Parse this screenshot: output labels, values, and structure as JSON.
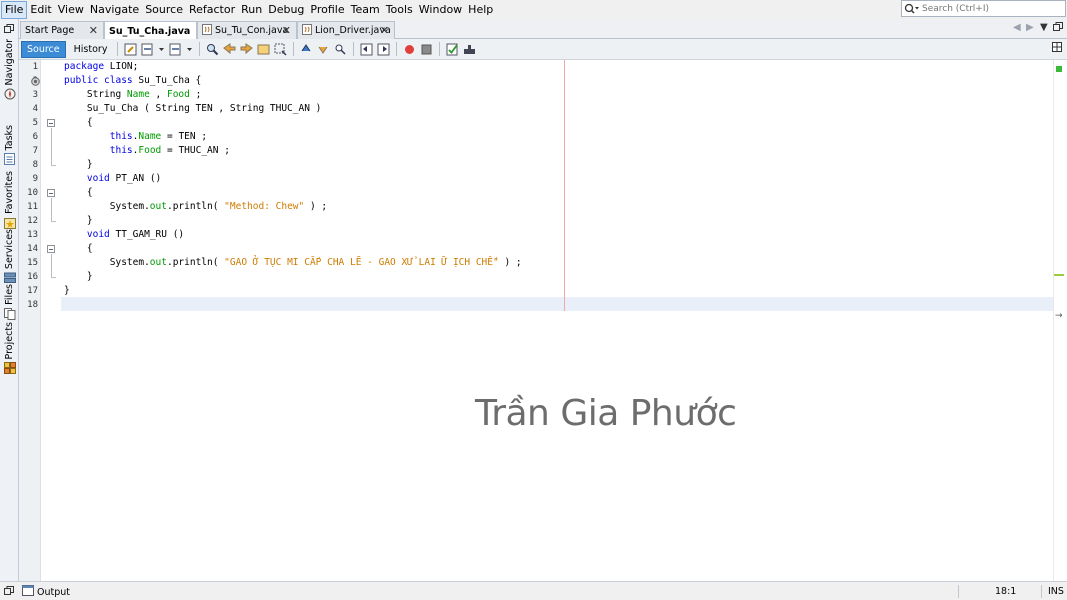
{
  "menu": [
    "File",
    "Edit",
    "View",
    "Navigate",
    "Source",
    "Refactor",
    "Run",
    "Debug",
    "Profile",
    "Team",
    "Tools",
    "Window",
    "Help"
  ],
  "search": {
    "placeholder": "Search (Ctrl+I)"
  },
  "sidebar": {
    "items": [
      {
        "label": "Navigator",
        "icon": "navigator-icon"
      },
      {
        "label": "Tasks",
        "icon": "tasks-icon"
      },
      {
        "label": "Favorites",
        "icon": "favorites-icon"
      },
      {
        "label": "Services",
        "icon": "services-icon"
      },
      {
        "label": "Files",
        "icon": "files-icon"
      },
      {
        "label": "Projects",
        "icon": "projects-icon"
      }
    ]
  },
  "tabs": [
    {
      "label": "Start Page",
      "active": false
    },
    {
      "label": "Su_Tu_Cha.java",
      "active": true
    },
    {
      "label": "Su_Tu_Con.java",
      "active": false
    },
    {
      "label": "Lion_Driver.java",
      "active": false
    }
  ],
  "toolbar": {
    "source_label": "Source",
    "history_label": "History"
  },
  "code": {
    "line_numbers": [
      "1",
      "2",
      "3",
      "4",
      "5",
      "6",
      "7",
      "8",
      "9",
      "10",
      "11",
      "12",
      "13",
      "14",
      "15",
      "16",
      "17",
      "18"
    ],
    "lines": [
      [
        {
          "t": "package ",
          "c": "kw"
        },
        {
          "t": "LION;",
          "c": ""
        }
      ],
      [
        {
          "t": "public class ",
          "c": "kw"
        },
        {
          "t": "Su_Tu_Cha {",
          "c": ""
        }
      ],
      [
        {
          "t": "    String ",
          "c": ""
        },
        {
          "t": "Name",
          "c": "fld"
        },
        {
          "t": " , ",
          "c": ""
        },
        {
          "t": "Food",
          "c": "fld"
        },
        {
          "t": " ;",
          "c": ""
        }
      ],
      [
        {
          "t": "    Su_Tu_Cha ( String TEN , String THUC_AN )",
          "c": ""
        }
      ],
      [
        {
          "t": "    {",
          "c": ""
        }
      ],
      [
        {
          "t": "        ",
          "c": ""
        },
        {
          "t": "this",
          "c": "kw"
        },
        {
          "t": ".",
          "c": ""
        },
        {
          "t": "Name",
          "c": "fld"
        },
        {
          "t": " = TEN ;",
          "c": ""
        }
      ],
      [
        {
          "t": "        ",
          "c": ""
        },
        {
          "t": "this",
          "c": "kw"
        },
        {
          "t": ".",
          "c": ""
        },
        {
          "t": "Food",
          "c": "fld"
        },
        {
          "t": " = THUC_AN ;",
          "c": ""
        }
      ],
      [
        {
          "t": "    }",
          "c": ""
        }
      ],
      [
        {
          "t": "    ",
          "c": ""
        },
        {
          "t": "void",
          "c": "kw"
        },
        {
          "t": " PT_AN ()",
          "c": ""
        }
      ],
      [
        {
          "t": "    {",
          "c": ""
        }
      ],
      [
        {
          "t": "        System.",
          "c": ""
        },
        {
          "t": "out",
          "c": "fld"
        },
        {
          "t": ".println( ",
          "c": ""
        },
        {
          "t": "\"Method: Chew\"",
          "c": "str"
        },
        {
          "t": " ) ;",
          "c": ""
        }
      ],
      [
        {
          "t": "    }",
          "c": ""
        }
      ],
      [
        {
          "t": "    ",
          "c": ""
        },
        {
          "t": "void",
          "c": "kw"
        },
        {
          "t": " TT_GAM_RU ()",
          "c": ""
        }
      ],
      [
        {
          "t": "    {",
          "c": ""
        }
      ],
      [
        {
          "t": "        System.",
          "c": ""
        },
        {
          "t": "out",
          "c": "fld"
        },
        {
          "t": ".println( ",
          "c": ""
        },
        {
          "t": "\"GAO Ở TỤC MI CẮP CHA LẼ - GAO XỬ LAI Ữ ỊCH CHẾ\"",
          "c": "str"
        },
        {
          "t": " ) ;",
          "c": ""
        }
      ],
      [
        {
          "t": "    }",
          "c": ""
        }
      ],
      [
        {
          "t": "}",
          "c": ""
        }
      ],
      [
        {
          "t": "",
          "c": ""
        }
      ]
    ]
  },
  "watermark": "Trần Gia Phước",
  "status": {
    "output_label": "Output",
    "caret": "18:1",
    "mode": "INS"
  }
}
